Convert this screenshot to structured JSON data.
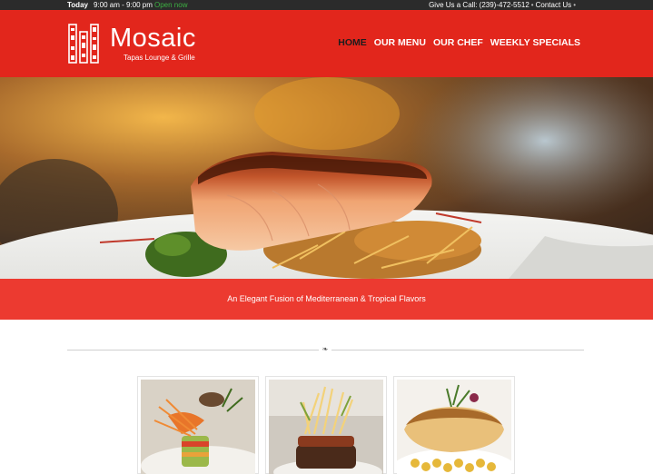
{
  "topbar": {
    "today_label": "Today",
    "hours": "9:00 am - 9:00 pm",
    "status": "Open now",
    "call_label": "Give Us a Call: (239)-472-5512",
    "contact_label": "Contact Us"
  },
  "brand": {
    "name": "Mosaic",
    "tagline": "Tapas Lounge & Grille"
  },
  "nav": {
    "items": [
      {
        "label": "HOME"
      },
      {
        "label": "OUR MENU"
      },
      {
        "label": "OUR CHEF"
      },
      {
        "label": "WEEKLY SPECIALS"
      }
    ]
  },
  "band": {
    "text": "An Elegant Fusion of Mediterranean & Tropical Flavors"
  },
  "divider": {
    "glyph": "❧"
  },
  "gallery": {
    "items": [
      {
        "icon": "food-photo-1"
      },
      {
        "icon": "food-photo-2"
      },
      {
        "icon": "food-photo-3"
      }
    ]
  },
  "colors": {
    "brand_red": "#e2261c",
    "band_red": "#ec3a30",
    "topbar_dark": "#2b2b2b",
    "open_green": "#3cb043"
  }
}
